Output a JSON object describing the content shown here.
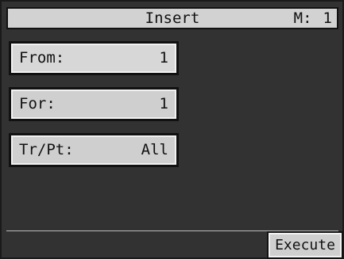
{
  "header": {
    "title": "Insert",
    "measure_label": "M:",
    "measure_value": "1"
  },
  "fields": [
    {
      "label": "From:",
      "value": "1"
    },
    {
      "label": "For:",
      "value": "1"
    },
    {
      "label": "Tr/Pt:",
      "value": "All"
    }
  ],
  "footer": {
    "execute_label": "Execute"
  },
  "colors": {
    "screen_bg": "#323232",
    "button_face": "#cfcfcf",
    "border_dark": "#111111",
    "border_light": "#f2f2f2"
  }
}
